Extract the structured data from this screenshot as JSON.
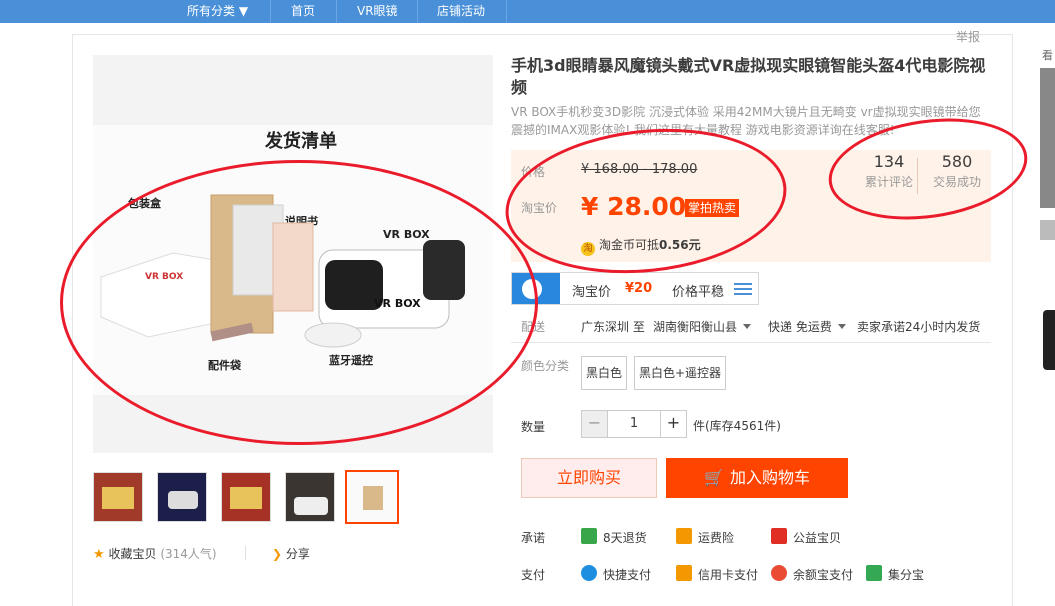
{
  "nav": {
    "all_categories": "所有分类 ▼",
    "home": "首页",
    "vr_glasses": "VR眼镜",
    "store_activity": "店铺活动"
  },
  "report": "举报",
  "side_label": "看",
  "product": {
    "title": "手机3d眼睛暴风魔镜头戴式VR虚拟现实眼镜智能头盔4代电影院视频",
    "subtitle": "VR BOX手机秒变3D影院 沉浸式体验 采用42MM大镜片且无畸变 vr虚拟现实眼镜带给您震撼的IMAX观影体验! 我们这里有大量教程 游戏电影资源详询在线客服!"
  },
  "price": {
    "label_price": "价格",
    "original": "¥ 168.00 - 178.00",
    "label_taobao": "淘宝价",
    "current": "¥ 28.00",
    "hot_tag": "掌拍热卖",
    "coin_text": "淘金币可抵",
    "coin_value": "0.56元",
    "coin_icon": "淘"
  },
  "stats": {
    "reviews_num": "134",
    "reviews_label": "累计评论",
    "deals_num": "580",
    "deals_label": "交易成功"
  },
  "trend": {
    "label": "淘宝价",
    "value": "¥20",
    "status": "价格平稳"
  },
  "shipping": {
    "label": "配送",
    "from": "广东深圳 至",
    "to": "湖南衡阳衡山县",
    "method": "快递 免运费",
    "promise": "卖家承诺24小时内发货"
  },
  "color": {
    "label": "颜色分类",
    "options": [
      "黑白色",
      "黑白色+遥控器"
    ]
  },
  "quantity": {
    "label": "数量",
    "minus": "−",
    "value": "1",
    "plus": "+",
    "stock": "件(库存4561件)"
  },
  "buttons": {
    "buy_now": "立即购买",
    "add_to_cart": "加入购物车"
  },
  "promise_row": {
    "label": "承诺",
    "items": [
      "8天退货",
      "运费险",
      "公益宝贝"
    ]
  },
  "payment_row": {
    "label": "支付",
    "items": [
      "快捷支付",
      "信用卡支付",
      "余额宝支付",
      "集分宝"
    ]
  },
  "gallery": {
    "main_heading": "发货清单",
    "labels": {
      "bag": "包装盒",
      "manual": "说明书",
      "vrbox": "VR BOX",
      "parts": "配件袋",
      "remote": "蓝牙遥控",
      "box_logo": "VR BOX",
      "headset_logo": "VR BOX"
    }
  },
  "collect": {
    "favorite": "收藏宝贝",
    "favorite_count": "(314人气)",
    "share": "分享"
  },
  "colors": {
    "accent": "#ff4400",
    "nav_blue": "#4a90d8",
    "annotation_red": "#ea1b2a"
  }
}
